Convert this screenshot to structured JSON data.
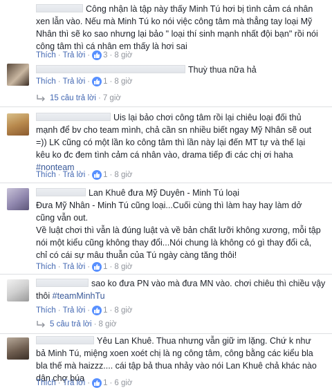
{
  "colors": {
    "link": "#4267b2",
    "meta": "#90949c",
    "text": "#1d2129",
    "like_badge": "#5890ff"
  },
  "action_labels": {
    "like": "Thích",
    "reply": "Trả lời"
  },
  "comments": [
    {
      "lines": [
        "Công nhận là tập này thấy Minh Tú hơi bị tình cảm cá nhân",
        "xen lẫn vào. Nếu mà Minh Tú ko nói việc công tâm mà thẳng tay loại Mỹ",
        "Nhân thì sẽ ko sao nhưng lại bảo \" loại thí sinh mạnh nhất đội bạn\" rồi nói",
        "công tâm thì cá nhân em thấy là hơi sai"
      ],
      "likes": "3",
      "time": "8 giờ"
    },
    {
      "lines": [
        "Thuỳ thua nữa hả"
      ],
      "likes": "1",
      "time": "8 giờ",
      "replies": {
        "label": "15 câu trả lời",
        "time": "7 giờ"
      }
    },
    {
      "lines": [
        "Uis lại bảo chơi công tâm rồi lại chiêu loại đối thủ",
        "mạnh để bv cho team mình, chả cần sn nhiều biết ngay Mỹ Nhân sẽ out",
        "=)) LK cũng có một lần ko công tâm thì lần này lại đến MT tự và thế lại",
        "kêu ko đc đem tình cảm cá nhân vào, drama tiếp đi các chị ơi haha"
      ],
      "hashtag": "#nonteam",
      "likes": "1",
      "time": "8 giờ"
    },
    {
      "lines": [
        "Lan Khuê đưa Mỹ Duyên - Minh Tú loại",
        "Đưa Mỹ Nhân - Minh Tú cũng loại...Cuối cùng thì làm hay hay làm dở",
        "cũng vẫn out.",
        "Về luật chơi thì vẫn là đúng luật và về bản chất lưỡi không xương, mỗi tập",
        "nói một kiểu cũng không thay đổi...Nói chung là không có gì thay đổi cả,",
        "chỉ có cái sự mâu thuẫn của Tú ngày càng tăng thôi!"
      ],
      "likes": "1",
      "time": "8 giờ"
    },
    {
      "lines": [
        "sao ko đưa PN vào mà đưa MN vào. chơi chiêu thì chiều vậy",
        "thôi"
      ],
      "hashtag": "#teamMinhTu",
      "likes": "1",
      "time": "8 giờ",
      "replies": {
        "label": "5 câu trả lời",
        "time": "8 giờ"
      }
    },
    {
      "lines": [
        "Yêu Lan Khuê. Thua nhưng vẫn giữ im lặng. Chứ k như",
        "bả Minh Tú, miệng xoen xoét chị là ng công tâm, công bằng các kiểu bla",
        "bla thế mà haizzz.... cái tập bả thua nhảy vào nói Lan Khuê chả khác nào",
        "dân chợ búa"
      ],
      "likes": "1",
      "time": "6 giờ"
    }
  ]
}
